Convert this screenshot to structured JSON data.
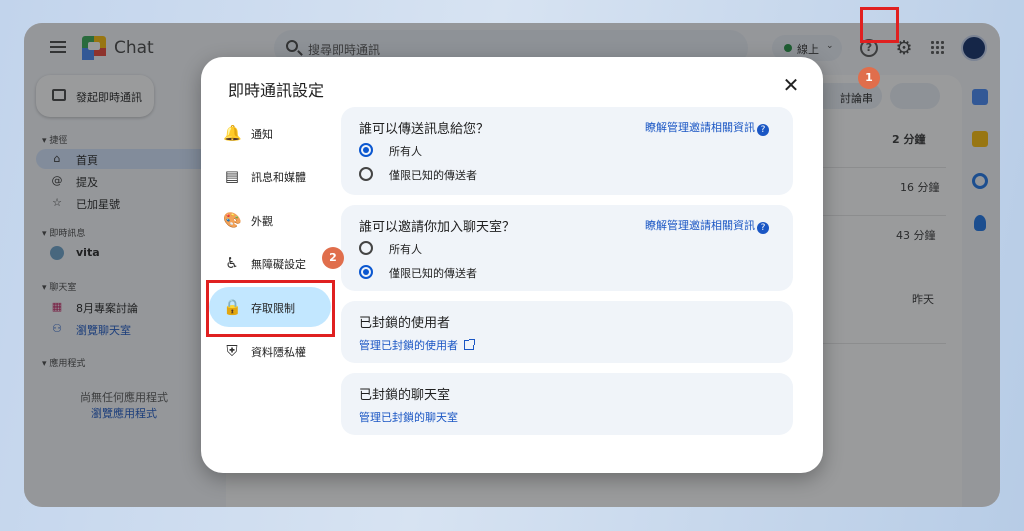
{
  "topbar": {
    "app_name": "Chat",
    "search_placeholder": "搜尋即時通訊",
    "status_label": "線上",
    "help_glyph": "?",
    "gear_glyph": "⚙"
  },
  "sidebar": {
    "new_chat_label": "發起即時通訊",
    "sections": [
      {
        "label": "▾ 捷徑"
      },
      {
        "label": "▾ 即時訊息"
      },
      {
        "label": "▾ 聊天室"
      },
      {
        "label": "▾ 應用程式"
      }
    ],
    "shortcuts": [
      {
        "icon": "⌂",
        "label": "首頁"
      },
      {
        "icon": "@",
        "label": "提及"
      },
      {
        "icon": "☆",
        "label": "已加星號"
      }
    ],
    "dm": {
      "label": "vita"
    },
    "spaces": [
      {
        "icon": "▦",
        "label": "8月專案討論"
      },
      {
        "icon": "⚇",
        "label": "瀏覽聊天室"
      }
    ],
    "apps_empty": "尚無任何應用程式",
    "apps_browse": "瀏覽應用程式"
  },
  "main": {
    "threads_label": "討論串",
    "times": [
      "2 分鐘",
      "16 分鐘",
      "43 分鐘",
      "昨天"
    ]
  },
  "dialog": {
    "title": "即時通訊設定",
    "close_glyph": "✕",
    "nav": [
      {
        "icon": "🔔",
        "label": "通知"
      },
      {
        "icon": "▤",
        "label": "訊息和媒體"
      },
      {
        "icon": "🎨",
        "label": "外觀"
      },
      {
        "icon": "♿",
        "label": "無障礙設定"
      },
      {
        "icon": "🔒",
        "label": "存取限制"
      },
      {
        "icon": "⛨",
        "label": "資料隱私權"
      }
    ],
    "message_card": {
      "title": "誰可以傳送訊息給您？",
      "link": "瞭解管理邀請相關資訊",
      "options": [
        "所有人",
        "僅限已知的傳送者"
      ]
    },
    "invite_card": {
      "title": "誰可以邀請你加入聊天室？",
      "link": "瞭解管理邀請相關資訊",
      "options": [
        "所有人",
        "僅限已知的傳送者"
      ]
    },
    "blocked_users_card": {
      "title": "已封鎖的使用者",
      "link": "管理已封鎖的使用者"
    },
    "blocked_spaces_card": {
      "title": "已封鎖的聊天室",
      "link": "管理已封鎖的聊天室"
    }
  },
  "annotations": {
    "badge_1": "1",
    "badge_2": "2"
  },
  "colors": {
    "accent": "#0b57d0",
    "highlight": "#e02020",
    "badge": "#e06e4c"
  }
}
